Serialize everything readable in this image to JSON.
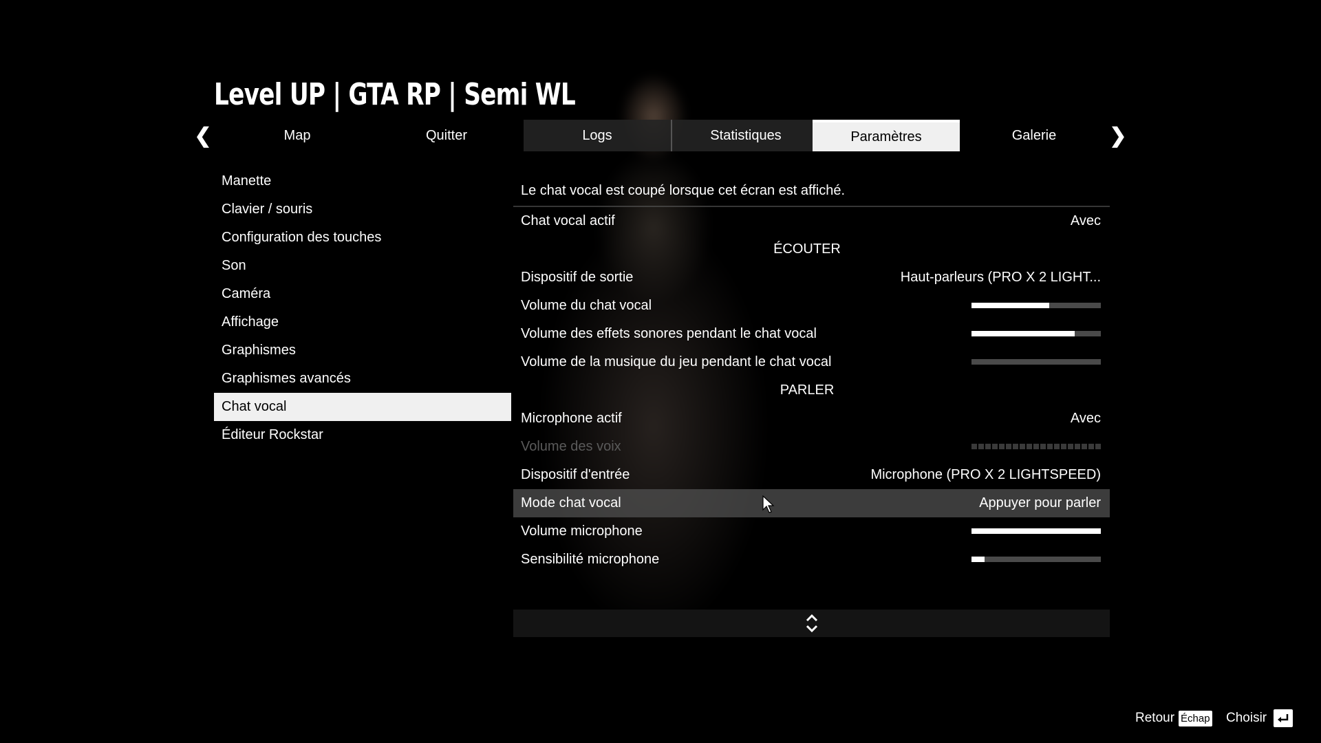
{
  "header": {
    "title": "Level UP | GTA RP | Semi WL"
  },
  "tabs": [
    {
      "label": "Map"
    },
    {
      "label": "Quitter"
    },
    {
      "label": "Logs"
    },
    {
      "label": "Statistiques"
    },
    {
      "label": "Paramètres",
      "active": true
    },
    {
      "label": "Galerie"
    }
  ],
  "left_menu": {
    "items": [
      {
        "label": "Manette"
      },
      {
        "label": "Clavier / souris"
      },
      {
        "label": "Configuration des touches"
      },
      {
        "label": "Son"
      },
      {
        "label": "Caméra"
      },
      {
        "label": "Affichage"
      },
      {
        "label": "Graphismes"
      },
      {
        "label": "Graphismes avancés"
      },
      {
        "label": "Chat vocal",
        "active": true
      },
      {
        "label": "Éditeur Rockstar"
      }
    ]
  },
  "panel": {
    "header": "Le chat vocal est coupé lorsque cet écran est affiché.",
    "rows": [
      {
        "label": "Chat vocal actif",
        "value": "Avec"
      },
      {
        "section": "ÉCOUTER"
      },
      {
        "label": "Dispositif de sortie",
        "value": "Haut-parleurs (PRO X 2 LIGHT..."
      },
      {
        "label": "Volume du chat vocal",
        "level": 0.6
      },
      {
        "label": "Volume des effets sonores pendant le chat vocal",
        "level": 0.8
      },
      {
        "label": "Volume de la musique du jeu pendant le chat vocal",
        "level": 0.0
      },
      {
        "section": "PARLER"
      },
      {
        "label": "Microphone actif",
        "value": "Avec"
      },
      {
        "label": "Volume des voix",
        "disabled": true
      },
      {
        "label": "Dispositif d'entrée",
        "value": "Microphone (PRO X 2 LIGHTSPEED)"
      },
      {
        "label": "Mode chat vocal",
        "value": "Appuyer pour parler",
        "highlighted": true
      },
      {
        "label": "Volume microphone",
        "level": 1.0
      },
      {
        "label": "Sensibilité microphone",
        "level": 0.1
      }
    ]
  },
  "footer": {
    "back_label": "Retour",
    "back_key": "Échap",
    "select_label": "Choisir"
  },
  "icons": {
    "prev": "chevron-left-icon",
    "next": "chevron-right-icon",
    "scroll": "scroll-updown-icon",
    "enter": "enter-key-icon",
    "cursor": "mouse-pointer-icon"
  },
  "colors": {
    "active_bg": "#f0f0f0",
    "highlight_bg": "#505050",
    "bar_bg": "#4a4a4a",
    "bar_fill": "#ffffff"
  }
}
